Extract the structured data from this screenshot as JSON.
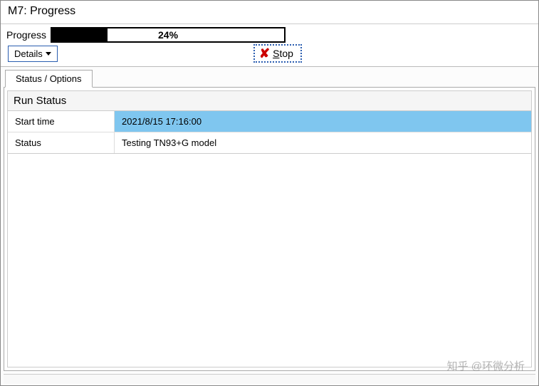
{
  "window": {
    "title": "M7: Progress"
  },
  "progress": {
    "label": "Progress",
    "percent": 24,
    "percent_text": "24%"
  },
  "buttons": {
    "details": "Details",
    "stop": "Stop"
  },
  "tabs": {
    "status_options": "Status / Options"
  },
  "panel": {
    "header": "Run Status",
    "rows": [
      {
        "key": "Start time",
        "value": "2021/8/15 17:16:00",
        "selected": true
      },
      {
        "key": "Status",
        "value": "Testing TN93+G model",
        "selected": false
      }
    ]
  },
  "watermark": "知乎 @环微分析"
}
